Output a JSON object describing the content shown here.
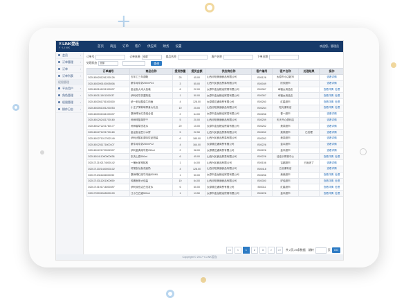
{
  "app": {
    "logo": "Y-LINK翌连",
    "logo_sub": "Y · L I N K",
    "user": "欢迎您，管理员"
  },
  "nav": [
    "首页",
    "商品",
    "订单",
    "客户",
    "供应商",
    "财务",
    "设置"
  ],
  "sidebar": {
    "items_top": [
      {
        "label": "会员",
        "icon": "user-icon"
      },
      {
        "label": "订单管理",
        "icon": "list-icon"
      },
      {
        "label": "订单",
        "icon": "doc-icon"
      },
      {
        "label": "订单列表",
        "icon": "doc-icon"
      }
    ],
    "section": "权限管理",
    "items_bottom": [
      {
        "label": "平台用户",
        "icon": "user-icon"
      },
      {
        "label": "角色管理",
        "icon": "role-icon"
      },
      {
        "label": "权限管理",
        "icon": "lock-icon"
      },
      {
        "label": "操作日志",
        "icon": "log-icon"
      }
    ]
  },
  "filters": {
    "order_no_label": "订单号",
    "order_no_value": "",
    "source_label": "订单来源",
    "source_value": "全部",
    "goods_label": "商品名称",
    "goods_value": "",
    "customer_label": "客户名称",
    "customer_value": "",
    "date_label": "下单日期",
    "date_value": "",
    "status_label": "处理状态",
    "status_value": "全部",
    "query_button": "查询"
  },
  "table": {
    "columns": [
      "订单编号",
      "商品名称",
      "提货数量",
      "提货金额",
      "供应商名称",
      "客户编号",
      "客户名称",
      "处理结果",
      "操作"
    ],
    "rows": [
      [
        "O201804281261200126",
        "五年工三年颈靴",
        "25",
        "45.00",
        "山西汾阳美通食品有限公司",
        "B00126",
        "太原市小店超市",
        "",
        "查看详情|"
      ],
      [
        "O201803090100005006",
        "蒙牛纯牛奶250ml*24",
        "3",
        "55.00",
        "山西兴民食品贸易有限公司",
        "B00049",
        "欣欣超市",
        "",
        "查看详情|"
      ],
      [
        "O201802161201300037",
        "金龙鱼大米大包装",
        "6",
        "22.00",
        "太原市金龙粮油贸易有限公司",
        "B00367",
        "幸福女用品店",
        "",
        "查看详情|处理"
      ],
      [
        "O201802111501300037",
        "伊利纯牛奶重购装",
        "1",
        "50.00",
        "太原市金龙粮油贸易有限公司",
        "B00367",
        "幸福女用品店",
        "",
        "查看详情|处理"
      ],
      [
        "O201802061751500300",
        "统一老坛酸菜牛肉面",
        "4",
        "128.00",
        "太原顺达通商贸有限公司",
        "B00260",
        "红星超市",
        "",
        "查看详情|处理"
      ],
      [
        "O201802061301200253",
        "小王子薄荷味零食大礼包",
        "10",
        "25.00",
        "山西汾阳美通食品有限公司",
        "B00264",
        "阳光便利店",
        "",
        "查看详情|处理"
      ],
      [
        "O201802031061000037",
        "康师傅冰红茶组合装",
        "2",
        "64.00",
        "太原市金龙粮油贸易有限公司",
        "B00258",
        "春一超市",
        "",
        "查看详情|"
      ],
      [
        "O201801262431700160",
        "师师坤篮单饼干",
        "5",
        "20.00",
        "山西汾阳美通食品有限公司",
        "B00259",
        "天天开心便利店",
        "",
        "查看详情|"
      ],
      [
        "O201801272221760177",
        "师师香草洗发水",
        "20",
        "15.00",
        "太原市金龙粮油贸易有限公司",
        "B00262",
        "美茶超市",
        "",
        "查看详情|"
      ],
      [
        "O201801271221700180",
        "金龙鱼油豆沙水饼",
        "5",
        "22.50",
        "山西兴民食品贸易有限公司",
        "B00262",
        "美茶超市",
        "已处理",
        "查看详情|"
      ],
      [
        "O201801271017002149",
        "伊利优酸乳原味饮品短装",
        "6",
        "180.00",
        "山西兴民食品贸易有限公司",
        "B00262",
        "美茶超市",
        "",
        "查看详情|"
      ],
      [
        "O201801251171600107",
        "蒙牛纯牛奶250ml*12",
        "4",
        "164.00",
        "太原顺达通商贸有限公司",
        "B00226",
        "金口超市",
        "",
        "查看详情|"
      ],
      [
        "O201801221720002007",
        "伊利金典纯牛奶250ml",
        "2",
        "98.00",
        "太原顺达通商贸有限公司",
        "B00226",
        "金口超市",
        "",
        "查看详情|"
      ],
      [
        "O201801411090000038",
        "农夫山泉550ml",
        "6",
        "45.00",
        "山西兴民食品贸易有限公司",
        "B00226",
        "佳佳乐购物中心",
        "",
        "查看详情|处理"
      ],
      [
        "O201712192174000142",
        "一桶水家常桃松",
        "1",
        "44.00",
        "山西兴民食品有限公司",
        "B00156",
        "吉超超市",
        "已返还了",
        "查看详情|"
      ],
      [
        "O201712021440003102",
        "好丽友仙鱼洗面奶",
        "4",
        "128.00",
        "山西汾阳美通食品有限公司",
        "B00418",
        "五泓便利店",
        "",
        "查看详情|"
      ],
      [
        "O201711061106000090",
        "康师傅红烧牛肉面500ML",
        "1",
        "50.00",
        "太原市金龙粮油贸易有限公司",
        "B00256",
        "美美超市",
        "",
        "查看详情|处理"
      ],
      [
        "O201710311201000059",
        "鸡蛋面条大包装",
        "10",
        "64.00",
        "山西汾阳美通食品有限公司",
        "B00300",
        "好佳超市",
        "",
        "查看详情|处理"
      ],
      [
        "O201710191716000397",
        "伊利双双洁白洗发水",
        "6",
        "60.00",
        "太原顺达通商贸有限公司",
        "B00311",
        "红星超市",
        "",
        "查看详情|处理"
      ],
      [
        "O201709091545000109",
        "江小白白酒500ml",
        "1",
        "13.50",
        "太原市金龙粮油贸易有限公司",
        "B00226",
        "金口超市",
        "",
        "查看详情|处理"
      ]
    ]
  },
  "pager": {
    "first": "<<",
    "prev": "<",
    "pages": [
      "1",
      "2",
      "3"
    ],
    "active_index": 0,
    "next": ">",
    "last": ">>",
    "info": "共 2页,25条数据",
    "goto_label": "跳转",
    "goto_unit": "页",
    "go_button": "GO"
  },
  "footer": "Copyright © 2017 Y-LINK翌连",
  "colors": {
    "topbar": "#173a69",
    "accent": "#2d7bc4",
    "link": "#2a6fb8"
  }
}
